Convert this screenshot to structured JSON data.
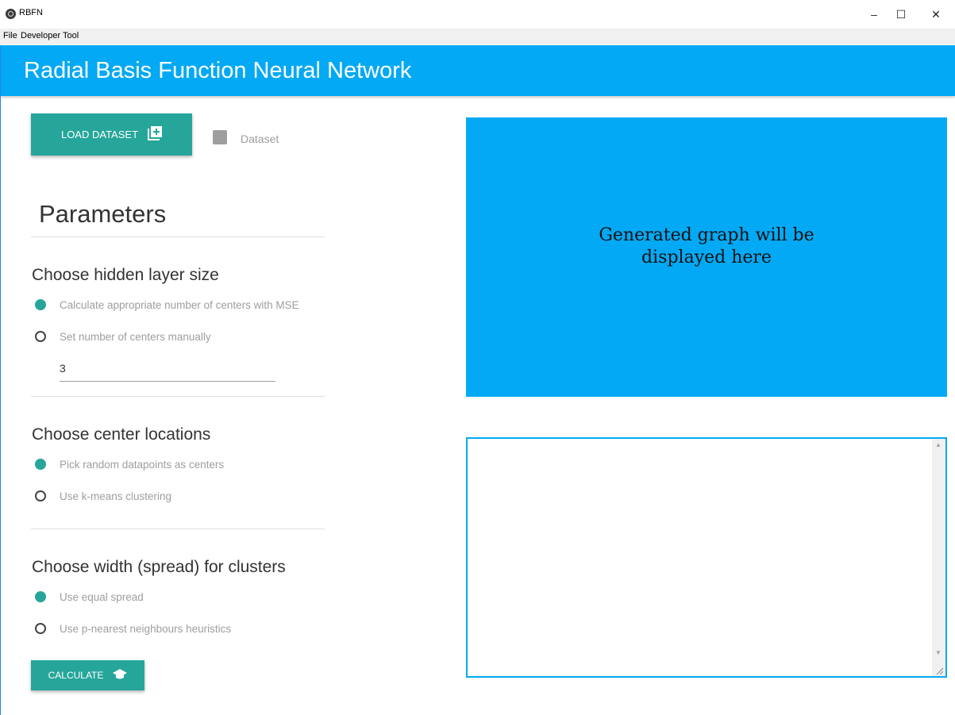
{
  "window": {
    "title": "RBFN",
    "minimize_glyph": "–",
    "maximize_glyph": "☐",
    "close_glyph": "✕"
  },
  "menu": {
    "items": [
      "File",
      "Developer Tool"
    ]
  },
  "header": {
    "title": "Radial Basis Function Neural Network",
    "color": "#03a9f4"
  },
  "dataset": {
    "load_button": "LOAD DATASET",
    "checkbox_label": "Dataset",
    "button_icon": "library-add-icon"
  },
  "parameters": {
    "title": "Parameters",
    "hidden_layer": {
      "title": "Choose hidden layer size",
      "options": [
        {
          "label": "Calculate appropriate number of centers with MSE",
          "checked": true
        },
        {
          "label": "Set number of centers manually",
          "checked": false
        }
      ],
      "centers_value": "3"
    },
    "center_locations": {
      "title": "Choose center locations",
      "options": [
        {
          "label": "Pick random datapoints as centers",
          "checked": true
        },
        {
          "label": "Use k-means clustering",
          "checked": false
        }
      ]
    },
    "spread": {
      "title": "Choose width (spread) for clusters",
      "options": [
        {
          "label": "Use equal spread",
          "checked": true
        },
        {
          "label": "Use p-nearest neighbours heuristics",
          "checked": false
        }
      ]
    }
  },
  "calculate": {
    "label": "CALCULATE",
    "icon": "graduation-cap-icon"
  },
  "graph": {
    "placeholder": "Generated graph will be\ndisplayed here"
  },
  "output": {
    "value": ""
  },
  "colors": {
    "accent": "#26a69a",
    "primary": "#03a9f4"
  }
}
